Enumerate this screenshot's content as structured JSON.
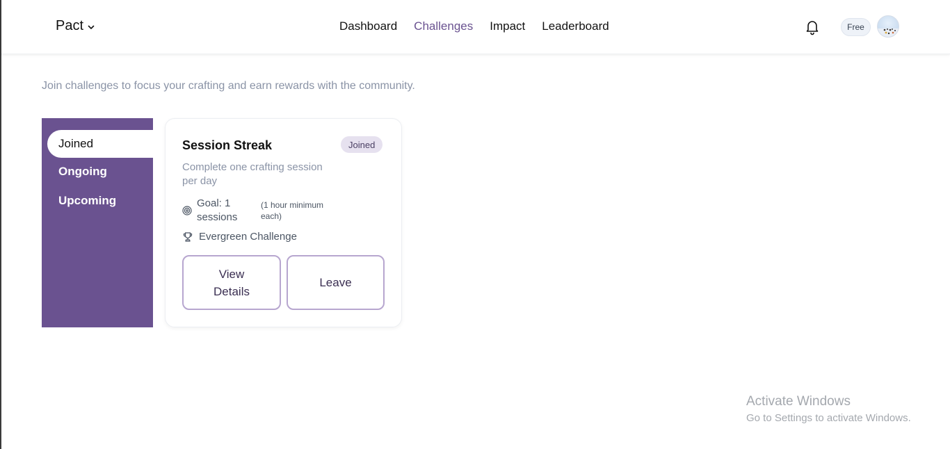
{
  "header": {
    "brand": "Pact",
    "nav": [
      {
        "label": "Dashboard"
      },
      {
        "label": "Challenges",
        "active": true
      },
      {
        "label": "Impact"
      },
      {
        "label": "Leaderboard"
      }
    ],
    "plan_badge": "Free",
    "icons": [
      "chevron-down-icon",
      "bell-icon",
      "avatar"
    ],
    "active_color": "#6a5290"
  },
  "page": {
    "subtitle": "Join challenges to focus your crafting and earn rewards with the community."
  },
  "sidebar": {
    "tabs": [
      {
        "label": "Joined",
        "active": true
      },
      {
        "label": "Ongoing"
      },
      {
        "label": "Upcoming"
      }
    ],
    "background": "#6a5290"
  },
  "challenge": {
    "title": "Session Streak",
    "status": "Joined",
    "description": "Complete one crafting session per day",
    "goal": "Goal: 1 sessions",
    "goal_note": "(1 hour minimum each)",
    "type": "Evergreen Challenge",
    "icons": [
      "target-icon",
      "trophy-icon"
    ],
    "buttons": {
      "view": "View Details",
      "leave": "Leave"
    }
  },
  "watermark": {
    "title": "Activate Windows",
    "subtitle": "Go to Settings to activate Windows."
  }
}
